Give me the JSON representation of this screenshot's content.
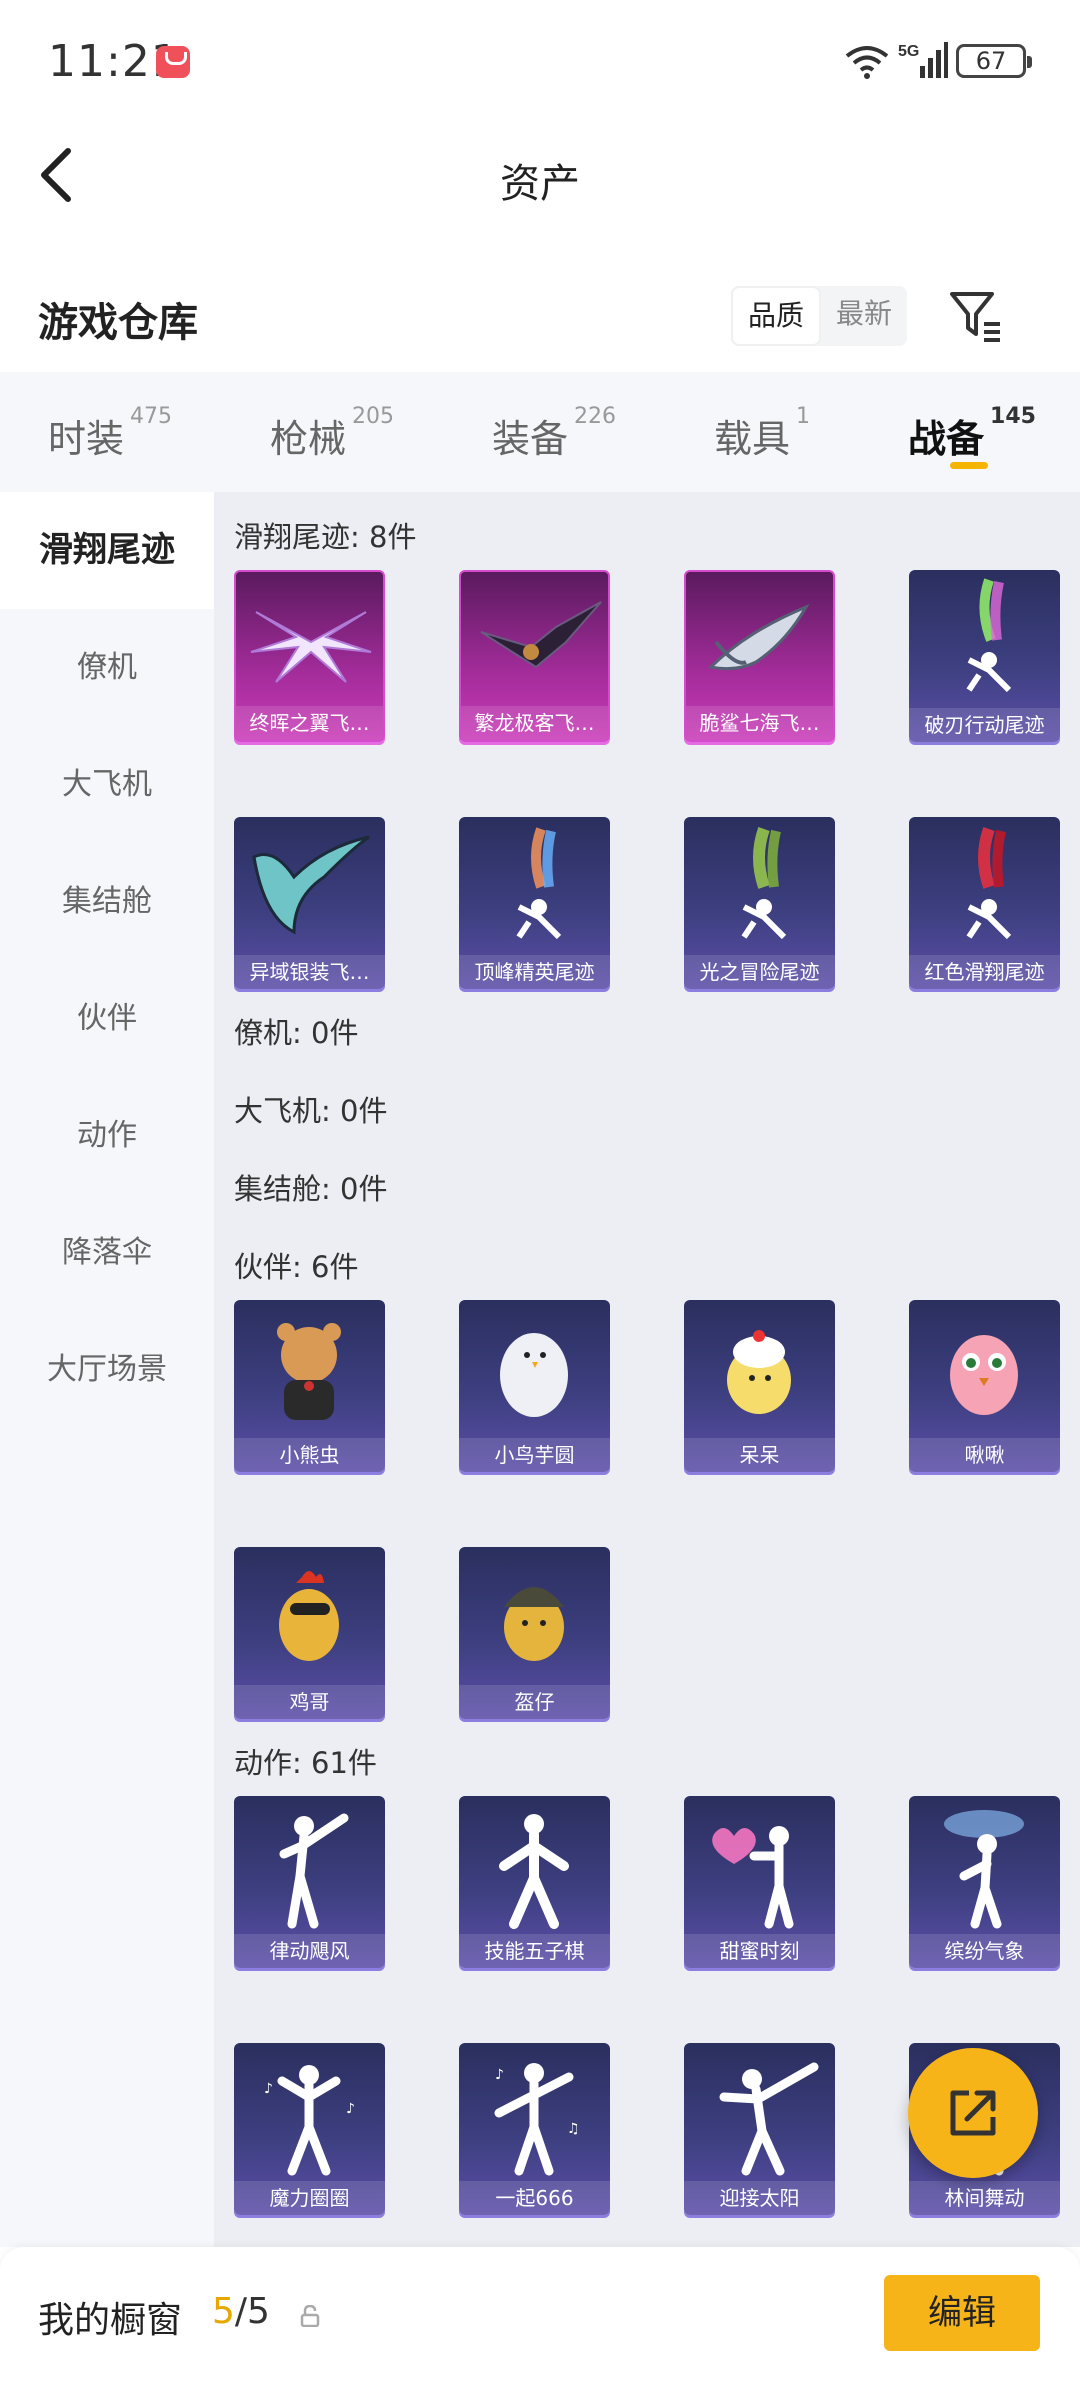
{
  "status_bar": {
    "time": "11:21",
    "network": "5G",
    "battery": "67"
  },
  "header": {
    "title": "资产",
    "back_icon": "chevron-left-icon"
  },
  "warehouse": {
    "title": "游戏仓库",
    "sort_options": [
      "品质",
      "最新"
    ],
    "sort_selected": "品质",
    "filter_icon": "filter-icon"
  },
  "tabs": [
    {
      "label": "时装",
      "count": "475"
    },
    {
      "label": "枪械",
      "count": "205"
    },
    {
      "label": "装备",
      "count": "226"
    },
    {
      "label": "载具",
      "count": "1"
    },
    {
      "label": "战备",
      "count": "145",
      "active": true
    }
  ],
  "sidebar": {
    "items": [
      {
        "label": "滑翔尾迹",
        "active": true
      },
      {
        "label": "僚机"
      },
      {
        "label": "大飞机"
      },
      {
        "label": "集结舱"
      },
      {
        "label": "伙伴"
      },
      {
        "label": "动作"
      },
      {
        "label": "降落伞"
      },
      {
        "label": "大厅场景"
      }
    ]
  },
  "sections": {
    "glide": {
      "title": "滑翔尾迹: 8件",
      "items": [
        "终晖之翼飞…",
        "繁龙极客飞…",
        "脆鲨七海飞…",
        "破刃行动尾迹",
        "异域银装飞…",
        "顶峰精英尾迹",
        "光之冒险尾迹",
        "红色滑翔尾迹"
      ]
    },
    "wingman": {
      "title": "僚机: 0件"
    },
    "plane": {
      "title": "大飞机: 0件"
    },
    "pod": {
      "title": "集结舱: 0件"
    },
    "partner": {
      "title": "伙伴: 6件",
      "items": [
        "小熊虫",
        "小鸟芋圆",
        "呆呆",
        "啾啾",
        "鸡哥",
        "盔仔"
      ]
    },
    "emote": {
      "title": "动作: 61件",
      "items": [
        "律动飓风",
        "技能五子棋",
        "甜蜜时刻",
        "缤纷气象",
        "魔力圈圈",
        "一起666",
        "迎接太阳",
        "林间舞动"
      ]
    }
  },
  "fab": {
    "icon": "share-external-icon"
  },
  "bottom_bar": {
    "label": "我的橱窗",
    "count_current": "5",
    "count_total": "/5",
    "lock_icon": "lock-icon",
    "edit_label": "编辑"
  }
}
